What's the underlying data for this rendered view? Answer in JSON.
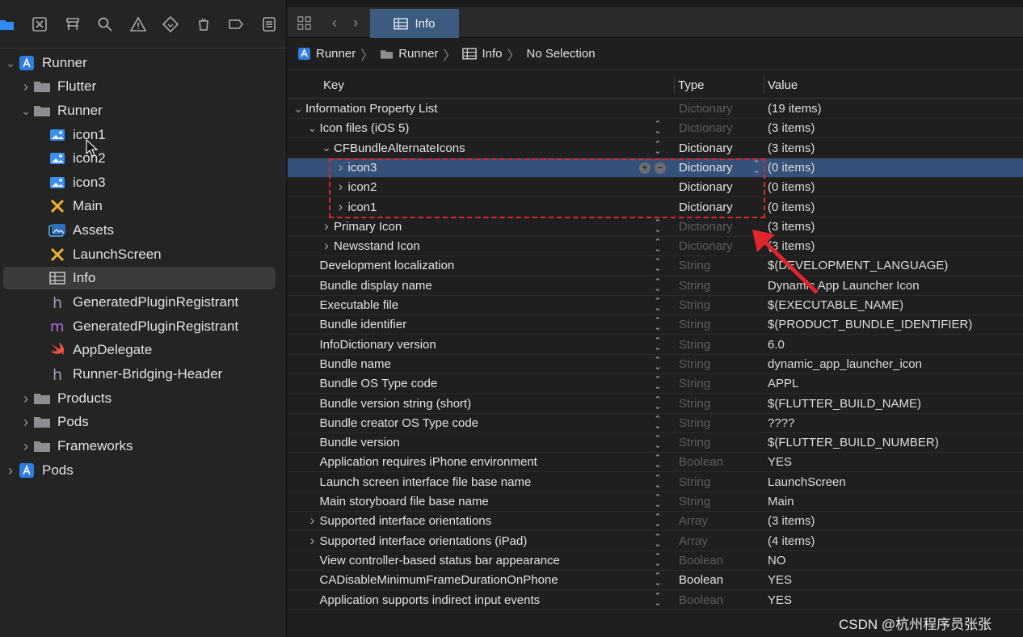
{
  "navigator": {
    "toolbar_icons": [
      "folder-icon",
      "source-control-icon",
      "hierarchy-icon",
      "search-icon",
      "warning-icon",
      "test-icon",
      "debug-icon",
      "breakpoint-icon",
      "report-icon"
    ],
    "items": [
      {
        "label": "Runner",
        "icon": "project-icon",
        "expanded": true
      },
      {
        "label": "Flutter",
        "icon": "folder-icon",
        "expanded": false
      },
      {
        "label": "Runner",
        "icon": "folder-icon",
        "expanded": true
      },
      {
        "label": "icon1",
        "icon": "image-icon"
      },
      {
        "label": "icon2",
        "icon": "image-icon"
      },
      {
        "label": "icon3",
        "icon": "image-icon"
      },
      {
        "label": "Main",
        "icon": "storyboard-icon"
      },
      {
        "label": "Assets",
        "icon": "asset-catalog-icon"
      },
      {
        "label": "LaunchScreen",
        "icon": "storyboard-icon"
      },
      {
        "label": "Info",
        "icon": "plist-icon",
        "selected": true
      },
      {
        "label": "GeneratedPluginRegistrant",
        "icon": "header-icon"
      },
      {
        "label": "GeneratedPluginRegistrant",
        "icon": "objc-file-icon"
      },
      {
        "label": "AppDelegate",
        "icon": "swift-icon"
      },
      {
        "label": "Runner-Bridging-Header",
        "icon": "header-icon"
      },
      {
        "label": "Products",
        "icon": "folder-icon",
        "expanded": false
      },
      {
        "label": "Pods",
        "icon": "folder-icon",
        "expanded": false
      },
      {
        "label": "Frameworks",
        "icon": "folder-icon",
        "expanded": false
      },
      {
        "label": "Pods",
        "icon": "project-icon",
        "expanded": false
      }
    ]
  },
  "tabbar": {
    "active_tab": "Info"
  },
  "jumpbar": {
    "crumbs": [
      "Runner",
      "Runner",
      "Info",
      "No Selection"
    ]
  },
  "plist": {
    "headers": {
      "key": "Key",
      "type": "Type",
      "value": "Value"
    },
    "rows": [
      {
        "key": "Information Property List",
        "type": "Dictionary",
        "value": "(19 items)",
        "type_dim": true,
        "disclosure": "down"
      },
      {
        "key": "Icon files (iOS 5)",
        "type": "Dictionary",
        "value": "(3 items)",
        "type_dim": true,
        "disclosure": "down"
      },
      {
        "key": "CFBundleAlternateIcons",
        "type": "Dictionary",
        "value": "(3 items)",
        "type_dim": false,
        "disclosure": "down"
      },
      {
        "key": "icon3",
        "type": "Dictionary",
        "value": "(0 items)",
        "type_dim": false,
        "disclosure": "right",
        "selected": true
      },
      {
        "key": "icon2",
        "type": "Dictionary",
        "value": "(0 items)",
        "type_dim": false,
        "disclosure": "right"
      },
      {
        "key": "icon1",
        "type": "Dictionary",
        "value": "(0 items)",
        "type_dim": false,
        "disclosure": "right"
      },
      {
        "key": "Primary Icon",
        "type": "Dictionary",
        "value": "(3 items)",
        "type_dim": true,
        "disclosure": "right"
      },
      {
        "key": "Newsstand Icon",
        "type": "Dictionary",
        "value": "(3 items)",
        "type_dim": true,
        "disclosure": "right"
      },
      {
        "key": "Development localization",
        "type": "String",
        "value": "$(DEVELOPMENT_LANGUAGE)",
        "type_dim": true
      },
      {
        "key": "Bundle display name",
        "type": "String",
        "value": "Dynamic App Launcher Icon",
        "type_dim": true
      },
      {
        "key": "Executable file",
        "type": "String",
        "value": "$(EXECUTABLE_NAME)",
        "type_dim": true
      },
      {
        "key": "Bundle identifier",
        "type": "String",
        "value": "$(PRODUCT_BUNDLE_IDENTIFIER)",
        "type_dim": true
      },
      {
        "key": "InfoDictionary version",
        "type": "String",
        "value": "6.0",
        "type_dim": true
      },
      {
        "key": "Bundle name",
        "type": "String",
        "value": "dynamic_app_launcher_icon",
        "type_dim": true
      },
      {
        "key": "Bundle OS Type code",
        "type": "String",
        "value": "APPL",
        "type_dim": true
      },
      {
        "key": "Bundle version string (short)",
        "type": "String",
        "value": "$(FLUTTER_BUILD_NAME)",
        "type_dim": true
      },
      {
        "key": "Bundle creator OS Type code",
        "type": "String",
        "value": "????",
        "type_dim": true
      },
      {
        "key": "Bundle version",
        "type": "String",
        "value": "$(FLUTTER_BUILD_NUMBER)",
        "type_dim": true
      },
      {
        "key": "Application requires iPhone environment",
        "type": "Boolean",
        "value": "YES",
        "type_dim": true
      },
      {
        "key": "Launch screen interface file base name",
        "type": "String",
        "value": "LaunchScreen",
        "type_dim": true
      },
      {
        "key": "Main storyboard file base name",
        "type": "String",
        "value": "Main",
        "type_dim": true
      },
      {
        "key": "Supported interface orientations",
        "type": "Array",
        "value": "(3 items)",
        "type_dim": true,
        "disclosure": "right"
      },
      {
        "key": "Supported interface orientations (iPad)",
        "type": "Array",
        "value": "(4 items)",
        "type_dim": true,
        "disclosure": "right"
      },
      {
        "key": "View controller-based status bar appearance",
        "type": "Boolean",
        "value": "NO",
        "type_dim": true
      },
      {
        "key": "CADisableMinimumFrameDurationOnPhone",
        "type": "Boolean",
        "value": "YES",
        "type_dim": false
      },
      {
        "key": "Application supports indirect input events",
        "type": "Boolean",
        "value": "YES",
        "type_dim": true
      }
    ]
  },
  "colors": {
    "accent": "#2f8cf5",
    "selection": "#35517a",
    "annotation": "#e0262b"
  },
  "watermark": "CSDN @杭州程序员张张"
}
